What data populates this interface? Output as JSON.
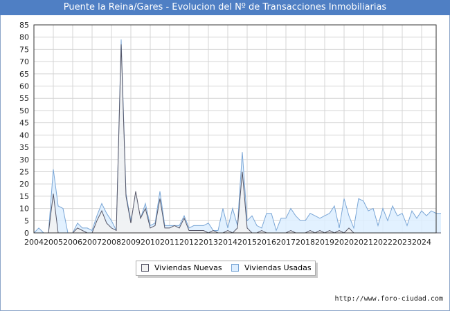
{
  "title": "Puente la Reina/Gares - Evolucion del Nº de Transacciones Inmobiliarias",
  "footer": "http://www.foro-ciudad.com",
  "colors": {
    "header": "#4f7fc4",
    "nuevas_fill": "#f2f2f2",
    "nuevas_line": "#555566",
    "usadas_fill": "#ddeeff",
    "usadas_line": "#7aa6d6",
    "grid": "#d4d4d4"
  },
  "chart_data": {
    "type": "area",
    "title": "Puente la Reina/Gares - Evolucion del Nº de Transacciones Inmobiliarias",
    "xlabel": "",
    "ylabel": "",
    "ylim": [
      0,
      85
    ],
    "xlim": [
      2004,
      2024.75
    ],
    "grid": true,
    "legend_position": "bottom",
    "y_ticks": [
      0,
      5,
      10,
      15,
      20,
      25,
      30,
      35,
      40,
      45,
      50,
      55,
      60,
      65,
      70,
      75,
      80,
      85
    ],
    "x_ticks": [
      "2004",
      "2005",
      "2006",
      "2007",
      "2008",
      "2009",
      "2010",
      "2011",
      "2012",
      "2013",
      "2014",
      "2015",
      "2016",
      "2017",
      "2018",
      "2019",
      "2020",
      "2021",
      "2022",
      "2023",
      "2024"
    ],
    "x_tick_values": [
      2004,
      2005,
      2006,
      2007,
      2008,
      2009,
      2010,
      2011,
      2012,
      2013,
      2014,
      2015,
      2016,
      2017,
      2018,
      2019,
      2020,
      2021,
      2022,
      2023,
      2024
    ],
    "x_start": 2004,
    "x_step": 0.25,
    "series": [
      {
        "name": "Viviendas Nuevas",
        "values": [
          0,
          0,
          0,
          0,
          16,
          0,
          0,
          0,
          0,
          2,
          1,
          0,
          0,
          5,
          9,
          4,
          2,
          1,
          77,
          15,
          4,
          17,
          6,
          10,
          2,
          3,
          14,
          2,
          2,
          3,
          2,
          6,
          1,
          1,
          1,
          1,
          0,
          1,
          0,
          0,
          1,
          0,
          2,
          25,
          2,
          0,
          0,
          1,
          0,
          0,
          0,
          0,
          0,
          1,
          0,
          0,
          0,
          1,
          0,
          1,
          0,
          1,
          0,
          1,
          0,
          2,
          0,
          0,
          0,
          0,
          0,
          0,
          0,
          0,
          0,
          0,
          0,
          0,
          0,
          0,
          0,
          0,
          0,
          0,
          0
        ]
      },
      {
        "name": "Viviendas Usadas",
        "values": [
          0,
          2,
          0,
          0,
          26,
          11,
          10,
          0,
          0,
          4,
          2,
          2,
          1,
          7,
          12,
          8,
          5,
          1,
          79,
          16,
          5,
          15,
          6,
          12,
          3,
          4,
          17,
          3,
          3,
          3,
          3,
          7,
          2,
          3,
          3,
          3,
          4,
          1,
          1,
          10,
          2,
          10,
          3,
          33,
          5,
          7,
          3,
          2,
          8,
          8,
          1,
          6,
          6,
          10,
          7,
          5,
          5,
          8,
          7,
          6,
          7,
          8,
          11,
          2,
          14,
          7,
          2,
          14,
          13,
          9,
          10,
          3,
          10,
          5,
          11,
          7,
          8,
          3,
          9,
          6,
          9,
          7,
          9,
          8,
          8
        ]
      }
    ]
  },
  "legend": {
    "nuevas": "Viviendas Nuevas",
    "usadas": "Viviendas Usadas"
  }
}
